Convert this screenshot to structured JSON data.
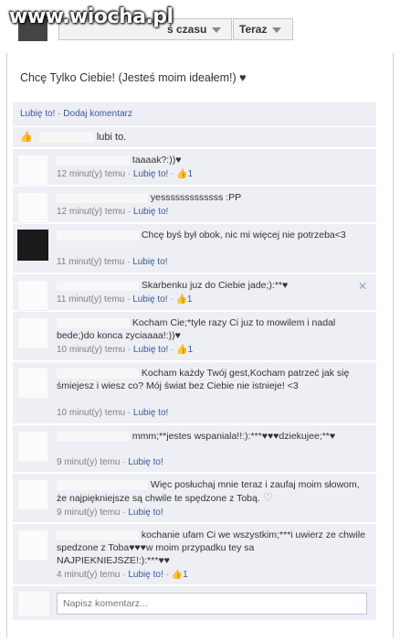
{
  "watermark": "www.wiocha.pl",
  "filters": {
    "sort_label": "Od czasu",
    "sort_visible": "ś czasu",
    "time_label": "Teraz"
  },
  "post": {
    "text": "Chcę Tylko Ciebie! (Jesteś moim ideałem!) ♥"
  },
  "actions": {
    "like": "Lubię to!",
    "separator": "·",
    "comment": "Dodaj komentarz"
  },
  "likes": {
    "text": "lubi to."
  },
  "comments": [
    {
      "text": "taaaak?:))♥",
      "time": "12 minut(y) temu",
      "like": "Lubię to!",
      "count": "1",
      "has_count": true
    },
    {
      "text": "yesssssssssssss :PP",
      "time": "12 minut(y) temu",
      "like": "Lubię to!",
      "count": "",
      "has_count": false
    },
    {
      "text": "Chcę byś był obok, nic mi więcej nie potrzeba<3",
      "time": "11 minut(y) temu",
      "like": "Lubię to!",
      "count": "",
      "has_count": false
    },
    {
      "text": "Skarbenku juz do Ciebie jade;):**♥",
      "time": "11 minut(y) temu",
      "like": "Lubię to!",
      "count": "1",
      "has_count": true
    },
    {
      "text": "Kocham Cie;*tyle razy Ci juz to mowilem i nadal bede;)do konca zyciaaaa!:))♥",
      "time": "10 minut(y) temu",
      "like": "Lubię to!",
      "count": "1",
      "has_count": true
    },
    {
      "text": "Kocham każdy Twój gest,Kocham patrzeć jak się śmiejesz i wiesz co? Mój świat bez Ciebie nie istnieje! <3",
      "time": "10 minut(y) temu",
      "like": "Lubię to!",
      "count": "",
      "has_count": false
    },
    {
      "text": "mmm;**jestes wspaniala!!:):***♥♥♥dziekujee;**♥",
      "time": "9 minut(y) temu",
      "like": "Lubię to!",
      "count": "",
      "has_count": false
    },
    {
      "text": "Więc posłuchaj mnie teraz i zaufaj moim słowom, że najpiękniejsze są chwile te spędzone z Tobą.",
      "time": "9 minut(y) temu",
      "like": "Lubię to!",
      "count": "",
      "has_count": false
    },
    {
      "text": "kochanie ufam Ci we wszystkim;***i uwierz ze chwile spedzone z Toba♥♥♥w moim przypadku tey sa NAJPIEKNIEJSZE!:):***♥♥",
      "time": "4 minut(y) temu",
      "like": "Lubię to!",
      "count": "1",
      "has_count": true
    }
  ],
  "compose": {
    "placeholder": "Napisz komentarz..."
  },
  "colors": {
    "link": "#3b5998",
    "panel": "#edeff4",
    "heart": "#e46b6b"
  }
}
